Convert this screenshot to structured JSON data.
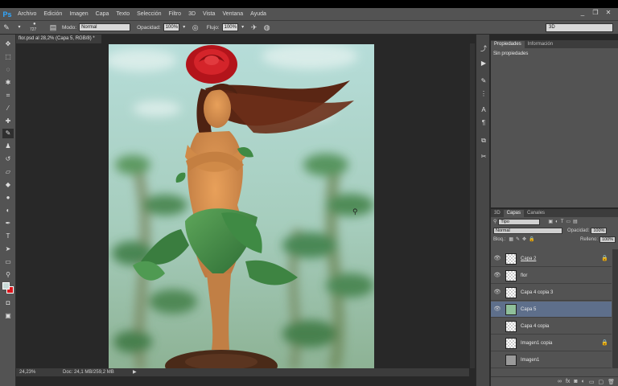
{
  "app": {
    "logo": "Ps"
  },
  "menu": [
    "Archivo",
    "Edición",
    "Imagen",
    "Capa",
    "Texto",
    "Selección",
    "Filtro",
    "3D",
    "Vista",
    "Ventana",
    "Ayuda"
  ],
  "window_controls": [
    "_",
    "❐",
    "✕"
  ],
  "options": {
    "brush_size": "727",
    "mode_label": "Modo:",
    "mode_value": "Normal",
    "opacity_label": "Opacidad:",
    "opacity_value": "100%",
    "flow_label": "Flujo:",
    "flow_value": "100%",
    "workspace": "3D"
  },
  "document": {
    "tab_title": "flor.psd al 28,2% (Capa 5, RGB/8) *",
    "zoom": "24,23%",
    "doc_size": "Doc: 24,1 MB/259,2 MB"
  },
  "properties": {
    "tabs": [
      "Propiedades",
      "Información"
    ],
    "body": "Sin propiedades"
  },
  "layers_panel": {
    "tabs": [
      "3D",
      "Capas",
      "Canales"
    ],
    "filter": "Tipo",
    "blend_mode": "Normal",
    "opacity_label": "Opacidad:",
    "opacity_value": "100%",
    "lock_label": "Bloq.:",
    "fill_label": "Relleno:",
    "fill_value": "100%",
    "layers": [
      {
        "name": "Capa 2",
        "visible": true,
        "locked": true,
        "selected": false,
        "thumb": "figure"
      },
      {
        "name": "flor",
        "visible": true,
        "locked": false,
        "selected": false,
        "thumb": "checker"
      },
      {
        "name": "Capa 4 copia 3",
        "visible": true,
        "locked": false,
        "selected": false,
        "thumb": "checker"
      },
      {
        "name": "Capa 5",
        "visible": true,
        "locked": false,
        "selected": true,
        "thumb": "green"
      },
      {
        "name": "Capa 4 copia",
        "visible": false,
        "locked": false,
        "selected": false,
        "thumb": "checker"
      },
      {
        "name": "Imagen1 copia",
        "visible": false,
        "locked": true,
        "selected": false,
        "thumb": "checker"
      },
      {
        "name": "Imagen1",
        "visible": false,
        "locked": false,
        "selected": false,
        "thumb": "gray"
      }
    ]
  },
  "colors": {
    "foreground": "#c8d9d7",
    "background": "#d9151b",
    "accent": "#31a8ff",
    "selected_layer": "#5e6f8b"
  }
}
